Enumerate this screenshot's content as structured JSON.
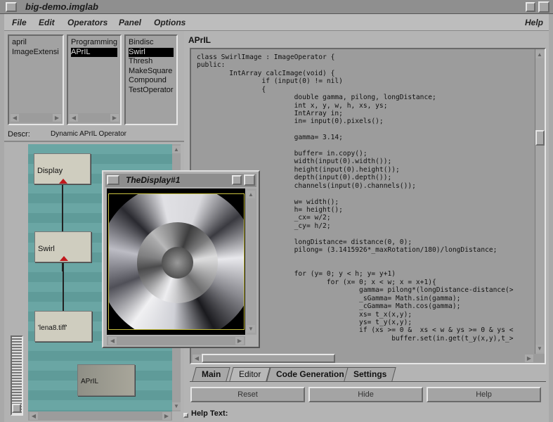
{
  "window": {
    "title": "big-demo.imglab"
  },
  "menu": {
    "items": [
      "File",
      "Edit",
      "Operators",
      "Panel",
      "Options"
    ],
    "help": "Help"
  },
  "lists": {
    "col1": [
      "april",
      "ImageExtensi"
    ],
    "col2": [
      "Programming",
      "APrIL"
    ],
    "col3": [
      "Bindisc",
      "Swirl",
      "Thresh",
      "MakeSquare",
      "Compound",
      "TestOperator"
    ],
    "col2_selected": "APrIL",
    "col3_selected": "Swirl"
  },
  "descr": {
    "label": "Descr:",
    "value": "Dynamic APrIL Operator"
  },
  "graph": {
    "nodes": [
      "Display",
      "Swirl",
      "'lena8.tiff'",
      "APrIL"
    ]
  },
  "display_window": {
    "title": "TheDisplay#1"
  },
  "editor": {
    "title": "APrIL",
    "code": [
      "class SwirlImage : ImageOperator {",
      "public:",
      "        IntArray calcImage(void) {",
      "                if (input(0) != nil)",
      "                {",
      "                        double gamma, pilong, longDistance;",
      "                        int x, y, w, h, xs, ys;",
      "                        IntArray in;",
      "                        in= input(0).pixels();",
      "",
      "                        gamma= 3.14;",
      "",
      "                        buffer= in.copy();",
      "                        width(input(0).width());",
      "                        height(input(0).height());",
      "                        depth(input(0).depth());",
      "                        channels(input(0).channels());",
      "",
      "                        w= width();",
      "                        h= height();",
      "                        _cx= w/2;",
      "                        _cy= h/2;",
      "",
      "                        longDistance= distance(0, 0);",
      "                        pilong= (3.1415926*_maxRotation/180)/longDistance;",
      "",
      "",
      "                        for (y= 0; y < h; y= y+1)",
      "                                for (x= 0; x < w; x = x+1){",
      "                                        gamma= pilong*(longDistance-distance(>",
      "                                        _sGamma= Math.sin(gamma);",
      "                                        _cGamma= Math.cos(gamma);",
      "                                        xs= t_x(x,y);",
      "                                        ys= t_y(x,y);",
      "                                        if (xs >= 0 &  xs < w & ys >= 0 & ys <",
      "                                                buffer.set(in.get(t_y(x,y),t_>"
    ]
  },
  "tabs": [
    "Main",
    "Editor",
    "Code Generation",
    "Settings"
  ],
  "active_tab": "Editor",
  "buttons": {
    "reset": "Reset",
    "hide": "Hide",
    "help": "Help"
  },
  "help_text": {
    "label": "Help Text:"
  }
}
